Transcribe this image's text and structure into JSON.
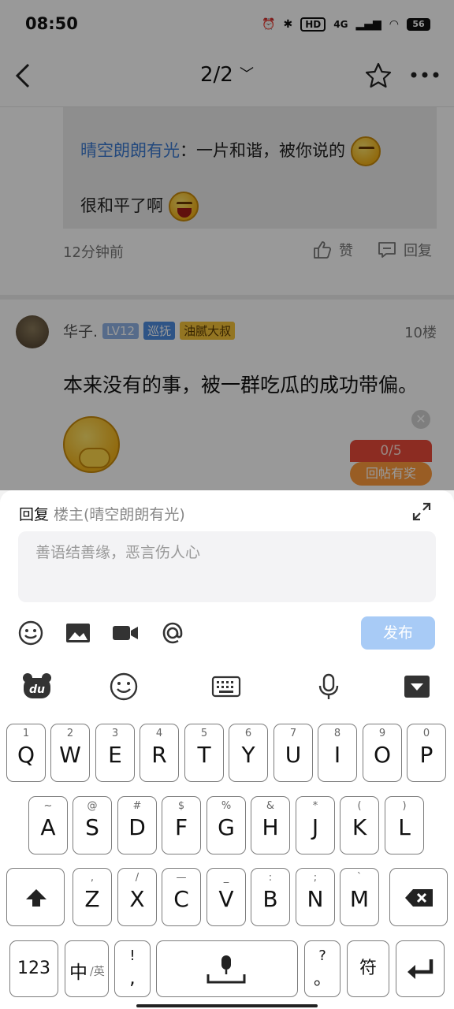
{
  "status": {
    "time": "08:50",
    "hd": "HD",
    "network": "4G",
    "battery": "56"
  },
  "header": {
    "page_indicator": "2/2"
  },
  "quote": {
    "username": "晴空朗朗有光",
    "text_line1": "：一片和谐，被你说的",
    "text_line2": "很和平了啊"
  },
  "comment_meta": {
    "time": "12分钟前",
    "like_label": "赞",
    "reply_label": "回复"
  },
  "post": {
    "author": "华子.",
    "level_tag": "LV12",
    "tag2": "巡抚",
    "tag3": "油腻大叔",
    "floor": "10楼",
    "text": "本来没有的事，被一群吃瓜的成功带偏。"
  },
  "reward": {
    "count": "0/5",
    "label": "回帖有奖"
  },
  "reply_panel": {
    "label": "回复",
    "target": "楼主(晴空朗朗有光)",
    "placeholder": "善语结善缘，恶言伤人心",
    "publish_label": "发布"
  },
  "keyboard": {
    "row1": [
      {
        "hint": "1",
        "key": "Q"
      },
      {
        "hint": "2",
        "key": "W"
      },
      {
        "hint": "3",
        "key": "E"
      },
      {
        "hint": "4",
        "key": "R"
      },
      {
        "hint": "5",
        "key": "T"
      },
      {
        "hint": "6",
        "key": "Y"
      },
      {
        "hint": "7",
        "key": "U"
      },
      {
        "hint": "8",
        "key": "I"
      },
      {
        "hint": "9",
        "key": "O"
      },
      {
        "hint": "0",
        "key": "P"
      }
    ],
    "row2": [
      {
        "hint": "~",
        "key": "A"
      },
      {
        "hint": "@",
        "key": "S"
      },
      {
        "hint": "#",
        "key": "D"
      },
      {
        "hint": "$",
        "key": "F"
      },
      {
        "hint": "%",
        "key": "G"
      },
      {
        "hint": "&",
        "key": "H"
      },
      {
        "hint": "*",
        "key": "J"
      },
      {
        "hint": "(",
        "key": "K"
      },
      {
        "hint": ")",
        "key": "L"
      }
    ],
    "row3": [
      {
        "hint": ",",
        "key": "Z"
      },
      {
        "hint": "/",
        "key": "X"
      },
      {
        "hint": "—",
        "key": "C"
      },
      {
        "hint": "_",
        "key": "V"
      },
      {
        "hint": ":",
        "key": "B"
      },
      {
        "hint": ";",
        "key": "N"
      },
      {
        "hint": "`",
        "key": "M"
      }
    ],
    "num_key": "123",
    "lang_key_main": "中",
    "lang_key_sub": "/英",
    "punct_top": "!",
    "punct_bottom": ",",
    "punct2_top": "?",
    "punct2_bottom": "。",
    "symbol_key": "符"
  },
  "icons": {
    "back": "back-arrow-icon",
    "star": "star-icon",
    "more": "more-icon",
    "like": "thumbs-up-icon",
    "reply": "comment-icon",
    "expand": "expand-icon",
    "emoji": "emoji-icon",
    "image": "image-icon",
    "video": "video-icon",
    "mention": "at-icon"
  },
  "colors": {
    "accent": "#3c7bd1",
    "publish_disabled": "#a8cbf6",
    "reward_red": "#e94a3a",
    "reward_orange": "#ff9b3d"
  }
}
